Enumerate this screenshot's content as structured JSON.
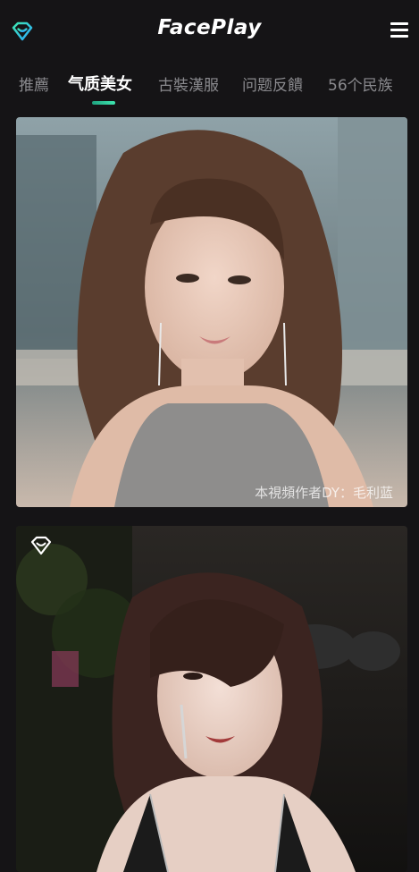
{
  "app": {
    "title": "FacePlay"
  },
  "icons": {
    "logo": "diamond-heart-icon",
    "menu": "hamburger-menu-icon",
    "favorite": "diamond-heart-icon"
  },
  "tabs": [
    {
      "label": "推薦"
    },
    {
      "label": "气质美女",
      "active": true
    },
    {
      "label": "古裝漢服"
    },
    {
      "label": "问题反饋"
    },
    {
      "label": "56个民族"
    }
  ],
  "cards": [
    {
      "watermark": "本視頻作者DY：毛利蓝"
    },
    {
      "watermark": ""
    }
  ],
  "colors": {
    "background": "#151416",
    "accent": "#3ee6b0",
    "logo": "#38c6ff"
  }
}
